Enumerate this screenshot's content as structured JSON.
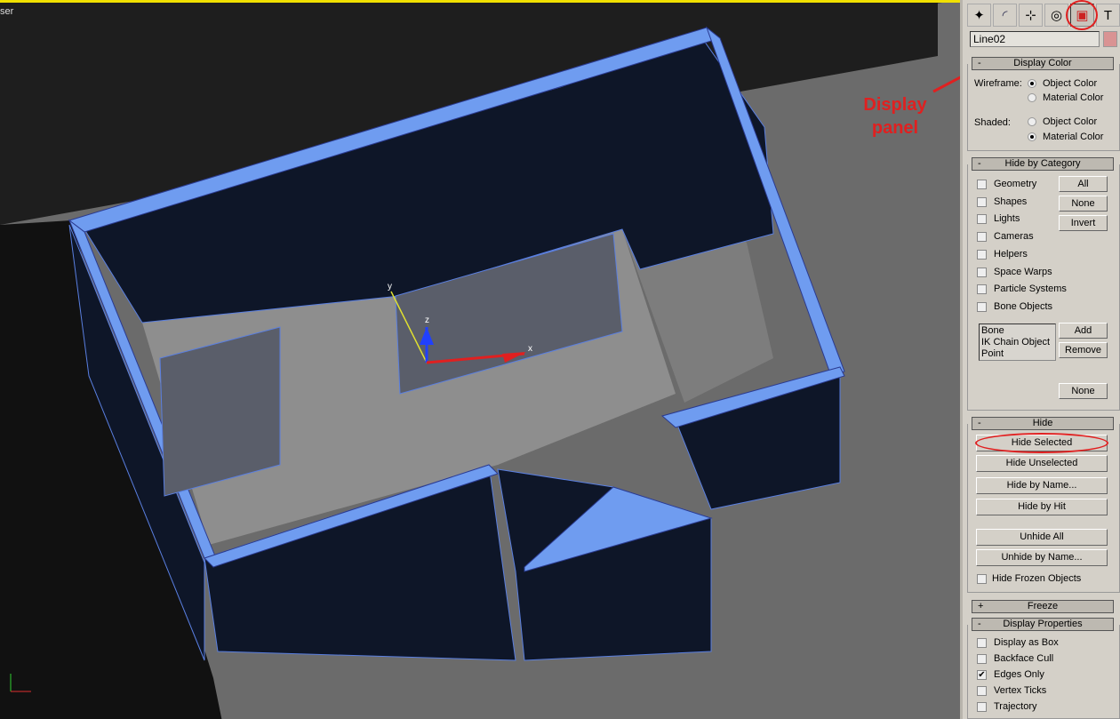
{
  "viewport": {
    "label": "ser",
    "axis_labels": {
      "x": "x",
      "y": "y",
      "z": "z"
    }
  },
  "annotation": {
    "text_line1": "Display",
    "text_line2": "panel",
    "color": "#e02020"
  },
  "command_panel": {
    "tabs": [
      {
        "name": "create",
        "icon": "create-icon"
      },
      {
        "name": "modify",
        "icon": "modify-icon"
      },
      {
        "name": "hierarchy",
        "icon": "hierarchy-icon"
      },
      {
        "name": "motion",
        "icon": "motion-icon"
      },
      {
        "name": "display",
        "icon": "display-icon",
        "active": true
      },
      {
        "name": "utilities",
        "icon": "hammer-icon"
      }
    ],
    "object_name": "Line02",
    "object_color": "#d99393",
    "display_color": {
      "title": "Display Color",
      "sign": "-",
      "wireframe_label": "Wireframe:",
      "shaded_label": "Shaded:",
      "object_color": "Object Color",
      "material_color": "Material Color",
      "wireframe_selected": "Object Color",
      "shaded_selected": "Material Color"
    },
    "hide_by_category": {
      "title": "Hide by Category",
      "sign": "-",
      "items": [
        {
          "label": "Geometry",
          "checked": false
        },
        {
          "label": "Shapes",
          "checked": false
        },
        {
          "label": "Lights",
          "checked": false
        },
        {
          "label": "Cameras",
          "checked": false
        },
        {
          "label": "Helpers",
          "checked": false
        },
        {
          "label": "Space Warps",
          "checked": false
        },
        {
          "label": "Particle Systems",
          "checked": false
        },
        {
          "label": "Bone Objects",
          "checked": false
        }
      ],
      "all": "All",
      "none": "None",
      "invert": "Invert",
      "list": [
        "Bone",
        "IK Chain Object",
        "Point"
      ],
      "add": "Add",
      "remove": "Remove",
      "none2": "None"
    },
    "hide": {
      "title": "Hide",
      "sign": "-",
      "hide_selected": "Hide Selected",
      "hide_unselected": "Hide Unselected",
      "hide_by_name": "Hide by Name...",
      "hide_by_hit": "Hide by Hit",
      "unhide_all": "Unhide All",
      "unhide_by_name": "Unhide by Name...",
      "hide_frozen": "Hide Frozen Objects"
    },
    "freeze": {
      "title": "Freeze",
      "sign": "+"
    },
    "display_properties": {
      "title": "Display Properties",
      "sign": "-",
      "items": [
        {
          "label": "Display as Box",
          "checked": false
        },
        {
          "label": "Backface Cull",
          "checked": false
        },
        {
          "label": "Edges Only",
          "checked": true
        },
        {
          "label": "Vertex Ticks",
          "checked": false
        },
        {
          "label": "Trajectory",
          "checked": false
        }
      ]
    }
  }
}
